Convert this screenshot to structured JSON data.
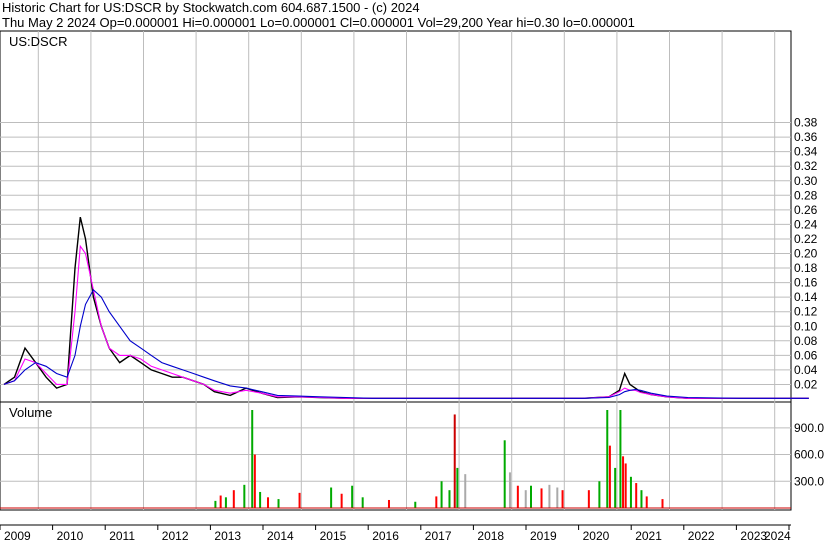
{
  "header": {
    "line1": "Historic Chart for US:DSCR by Stockwatch.com 604.687.1500 - (c) 2024",
    "line2": "Thu May  2 2024   Op=0.000001   Hi=0.000001   Lo=0.000001   Cl=0.000001   Vol=29,200   Year hi=0.30   lo=0.000001"
  },
  "chart_data": [
    {
      "type": "line",
      "title": "US:DSCR",
      "ylim": [
        0,
        0.4
      ],
      "yticks": [
        "0.38",
        "0.36",
        "0.34",
        "0.32",
        "0.30",
        "0.28",
        "0.26",
        "0.24",
        "0.22",
        "0.20",
        "0.18",
        "0.16",
        "0.14",
        "0.12",
        "0.10",
        "0.08",
        "0.06",
        "0.04",
        "0.02"
      ],
      "ytick_values": [
        0.38,
        0.36,
        0.34,
        0.32,
        0.3,
        0.28,
        0.26,
        0.24,
        0.22,
        0.2,
        0.18,
        0.16,
        0.14,
        0.12,
        0.1,
        0.08,
        0.06,
        0.04,
        0.02
      ],
      "xticks": [
        "2009",
        "2010",
        "2011",
        "2012",
        "2013",
        "2014",
        "2015",
        "2016",
        "2017",
        "2018",
        "2019",
        "2020",
        "2021",
        "2022",
        "2023",
        "2024"
      ],
      "x": [
        2009.0,
        2009.2,
        2009.4,
        2009.6,
        2009.8,
        2010.0,
        2010.2,
        2010.35,
        2010.45,
        2010.55,
        2010.7,
        2010.85,
        2011.0,
        2011.2,
        2011.4,
        2011.6,
        2011.8,
        2012.0,
        2012.2,
        2012.4,
        2012.6,
        2012.8,
        2013.0,
        2013.3,
        2013.6,
        2013.9,
        2014.2,
        2014.6,
        2015.0,
        2015.5,
        2016.0,
        2017.0,
        2018.0,
        2019.0,
        2020.0,
        2020.5,
        2020.7,
        2020.8,
        2020.9,
        2021.0,
        2021.1,
        2021.3,
        2021.6,
        2022.0,
        2023.0,
        2024.3
      ],
      "grid": true,
      "series": [
        {
          "name": "",
          "color": "#000000",
          "values": [
            0.02,
            0.03,
            0.07,
            0.05,
            0.03,
            0.015,
            0.02,
            0.18,
            0.25,
            0.22,
            0.14,
            0.1,
            0.07,
            0.05,
            0.06,
            0.05,
            0.04,
            0.035,
            0.03,
            0.03,
            0.025,
            0.02,
            0.01,
            0.005,
            0.015,
            0.008,
            0.002,
            0.003,
            0.002,
            0.001,
            0.001,
            0.001,
            0.001,
            0.001,
            0.001,
            0.003,
            0.012,
            0.035,
            0.02,
            0.015,
            0.01,
            0.006,
            0.003,
            0.001,
            0.001,
            0.001
          ]
        },
        {
          "name": "",
          "color": "#ff00ff",
          "values": [
            0.02,
            0.025,
            0.055,
            0.05,
            0.035,
            0.02,
            0.02,
            0.12,
            0.21,
            0.2,
            0.15,
            0.1,
            0.07,
            0.06,
            0.06,
            0.055,
            0.045,
            0.04,
            0.035,
            0.03,
            0.025,
            0.02,
            0.012,
            0.008,
            0.012,
            0.008,
            0.003,
            0.003,
            0.002,
            0.001,
            0.001,
            0.001,
            0.001,
            0.001,
            0.001,
            0.003,
            0.01,
            0.015,
            0.012,
            0.012,
            0.009,
            0.006,
            0.003,
            0.001,
            0.001,
            0.001
          ]
        },
        {
          "name": "",
          "color": "#0000cc",
          "values": [
            0.02,
            0.025,
            0.04,
            0.05,
            0.045,
            0.035,
            0.03,
            0.06,
            0.1,
            0.13,
            0.15,
            0.14,
            0.12,
            0.1,
            0.08,
            0.07,
            0.06,
            0.05,
            0.045,
            0.04,
            0.035,
            0.03,
            0.025,
            0.018,
            0.015,
            0.01,
            0.005,
            0.004,
            0.003,
            0.002,
            0.001,
            0.001,
            0.001,
            0.001,
            0.001,
            0.002,
            0.006,
            0.01,
            0.012,
            0.013,
            0.012,
            0.008,
            0.004,
            0.002,
            0.001,
            0.001
          ]
        }
      ]
    },
    {
      "type": "bar",
      "title": "Volume",
      "ylim": [
        0,
        1100
      ],
      "yticks": [
        "900.0",
        "600.0",
        "300.0"
      ],
      "ytick_values": [
        900,
        600,
        300
      ],
      "bars": [
        {
          "x": 2013.0,
          "v": 80,
          "c": "#00aa00"
        },
        {
          "x": 2013.1,
          "v": 140,
          "c": "#ff0000"
        },
        {
          "x": 2013.2,
          "v": 120,
          "c": "#00aa00"
        },
        {
          "x": 2013.35,
          "v": 200,
          "c": "#ff0000"
        },
        {
          "x": 2013.55,
          "v": 260,
          "c": "#00aa00"
        },
        {
          "x": 2013.7,
          "v": 1100,
          "c": "#00aa00"
        },
        {
          "x": 2013.75,
          "v": 600,
          "c": "#ff0000"
        },
        {
          "x": 2013.85,
          "v": 180,
          "c": "#00aa00"
        },
        {
          "x": 2014.0,
          "v": 120,
          "c": "#ff0000"
        },
        {
          "x": 2014.2,
          "v": 100,
          "c": "#00aa00"
        },
        {
          "x": 2014.6,
          "v": 170,
          "c": "#ff0000"
        },
        {
          "x": 2015.2,
          "v": 230,
          "c": "#00aa00"
        },
        {
          "x": 2015.4,
          "v": 160,
          "c": "#ff0000"
        },
        {
          "x": 2015.6,
          "v": 250,
          "c": "#00aa00"
        },
        {
          "x": 2015.8,
          "v": 120,
          "c": "#00aa00"
        },
        {
          "x": 2016.3,
          "v": 90,
          "c": "#ff0000"
        },
        {
          "x": 2016.8,
          "v": 70,
          "c": "#00aa00"
        },
        {
          "x": 2017.2,
          "v": 130,
          "c": "#ff0000"
        },
        {
          "x": 2017.3,
          "v": 300,
          "c": "#00aa00"
        },
        {
          "x": 2017.45,
          "v": 200,
          "c": "#00aa00"
        },
        {
          "x": 2017.55,
          "v": 1050,
          "c": "#cc0000"
        },
        {
          "x": 2017.6,
          "v": 450,
          "c": "#00aa00"
        },
        {
          "x": 2017.75,
          "v": 380,
          "c": "#aaaaaa"
        },
        {
          "x": 2018.5,
          "v": 760,
          "c": "#00aa00"
        },
        {
          "x": 2018.6,
          "v": 400,
          "c": "#aaaaaa"
        },
        {
          "x": 2018.75,
          "v": 250,
          "c": "#ff0000"
        },
        {
          "x": 2018.9,
          "v": 200,
          "c": "#aaaaaa"
        },
        {
          "x": 2019.0,
          "v": 250,
          "c": "#00aa00"
        },
        {
          "x": 2019.2,
          "v": 220,
          "c": "#ff0000"
        },
        {
          "x": 2019.35,
          "v": 260,
          "c": "#aaaaaa"
        },
        {
          "x": 2019.5,
          "v": 230,
          "c": "#aaaaaa"
        },
        {
          "x": 2019.6,
          "v": 200,
          "c": "#ff0000"
        },
        {
          "x": 2020.1,
          "v": 200,
          "c": "#ff0000"
        },
        {
          "x": 2020.3,
          "v": 300,
          "c": "#00aa00"
        },
        {
          "x": 2020.45,
          "v": 1100,
          "c": "#00aa00"
        },
        {
          "x": 2020.5,
          "v": 700,
          "c": "#ff0000"
        },
        {
          "x": 2020.6,
          "v": 450,
          "c": "#00aa00"
        },
        {
          "x": 2020.7,
          "v": 1100,
          "c": "#00aa00"
        },
        {
          "x": 2020.75,
          "v": 580,
          "c": "#ff0000"
        },
        {
          "x": 2020.8,
          "v": 500,
          "c": "#ff0000"
        },
        {
          "x": 2020.9,
          "v": 350,
          "c": "#00aa00"
        },
        {
          "x": 2021.0,
          "v": 280,
          "c": "#ff0000"
        },
        {
          "x": 2021.1,
          "v": 200,
          "c": "#00aa00"
        },
        {
          "x": 2021.2,
          "v": 130,
          "c": "#ff0000"
        },
        {
          "x": 2021.5,
          "v": 100,
          "c": "#ff0000"
        }
      ]
    }
  ]
}
